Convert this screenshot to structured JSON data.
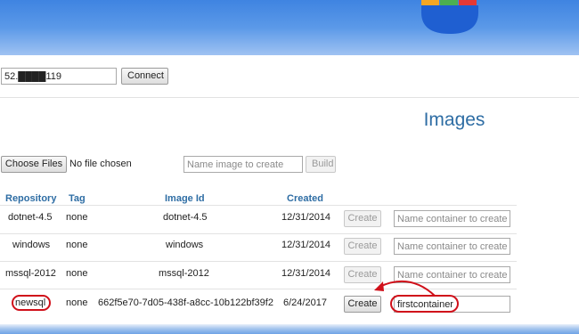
{
  "connection": {
    "host_value": "52.████119",
    "connect_label": "Connect"
  },
  "images_section": {
    "title": "Images",
    "choose_files_label": "Choose Files",
    "no_file_text": "No file chosen",
    "name_image_placeholder": "Name image to create",
    "build_label": "Build"
  },
  "table": {
    "headers": {
      "repository": "Repository",
      "tag": "Tag",
      "image_id": "Image Id",
      "created": "Created"
    },
    "rows": [
      {
        "repository": "dotnet-4.5",
        "tag": "none",
        "image_id": "dotnet-4.5",
        "created": "12/31/2014",
        "create_label": "Create",
        "container_value": "",
        "container_placeholder": "Name container to create"
      },
      {
        "repository": "windows",
        "tag": "none",
        "image_id": "windows",
        "created": "12/31/2014",
        "create_label": "Create",
        "container_value": "",
        "container_placeholder": "Name container to create"
      },
      {
        "repository": "mssql-2012",
        "tag": "none",
        "image_id": "mssql-2012",
        "created": "12/31/2014",
        "create_label": "Create",
        "container_value": "",
        "container_placeholder": "Name container to create"
      },
      {
        "repository": "newsql",
        "tag": "none",
        "image_id": "662f5e70-7d05-438f-a8cc-10b122bf39f2",
        "created": "6/24/2017",
        "create_label": "Create",
        "container_value": "firstcontainer",
        "container_placeholder": "Name container to create"
      }
    ]
  },
  "colors": {
    "header_blue": "#3f84e1",
    "title_blue": "#2e6da4",
    "annotation_red": "#d0101a"
  }
}
